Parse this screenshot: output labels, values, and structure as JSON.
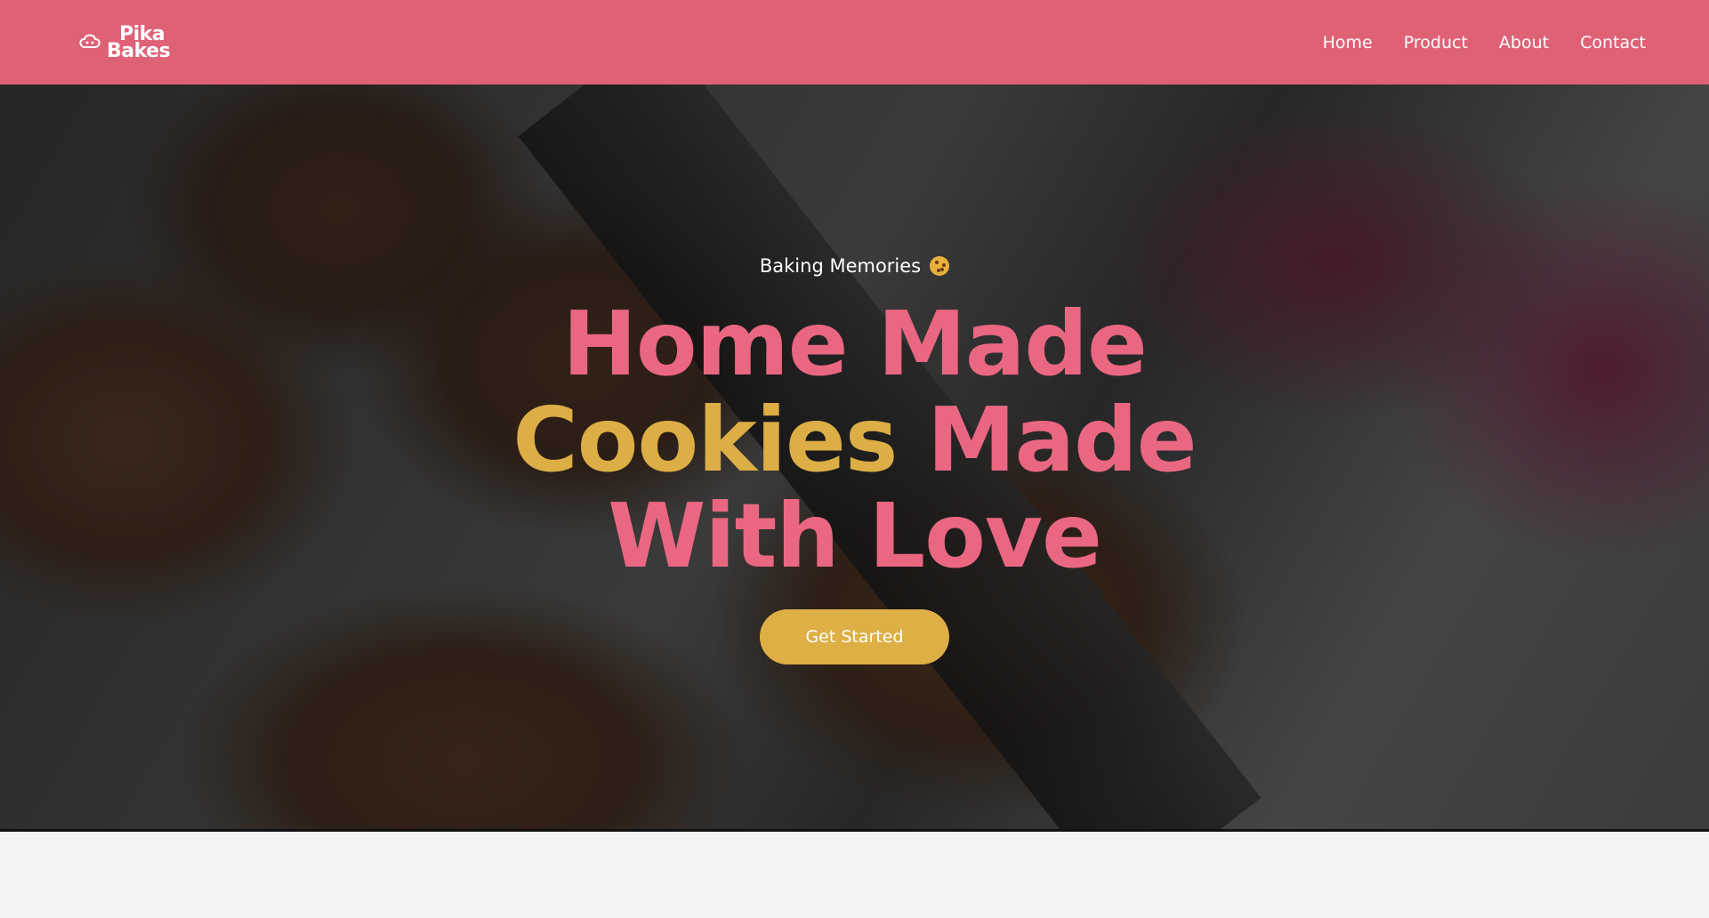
{
  "brand": {
    "name_line1": "Pika",
    "name_line2": "Bakes",
    "color": "#df6176"
  },
  "nav": {
    "items": [
      {
        "label": "Home"
      },
      {
        "label": "Product"
      },
      {
        "label": "About"
      },
      {
        "label": "Contact"
      }
    ]
  },
  "hero": {
    "tagline": "Baking Memories",
    "headline": {
      "line1": "Home Made",
      "line2_gold": "Cookies",
      "line2_pink": "Made",
      "line3": "With Love"
    },
    "cta_label": "Get Started",
    "colors": {
      "pink": "#ea6781",
      "gold": "#ddae45"
    }
  }
}
